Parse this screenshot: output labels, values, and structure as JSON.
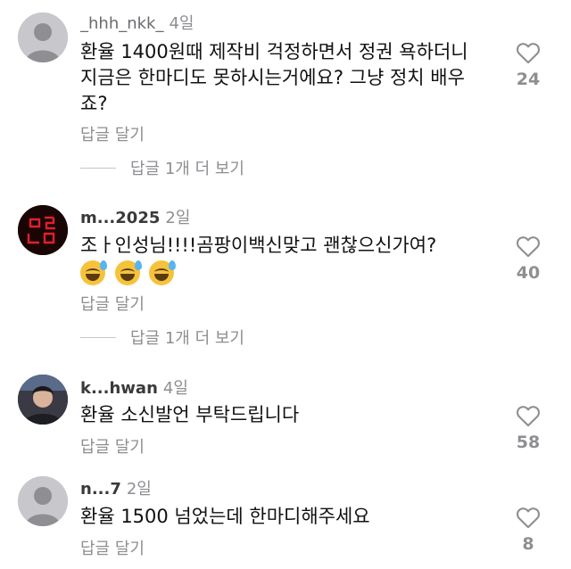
{
  "reply_label": "답글 달기",
  "comments": [
    {
      "username": "_hhh_nkk_",
      "time": "4일",
      "text": "환율 1400원때 제작비 걱정하면서 정권 욕하더니 지금은 한마디도 못하시는거에요? 그냥 정치 배우죠?",
      "likes": "24",
      "more_replies": "답글 1개 더 보기"
    },
    {
      "username": "m...2025",
      "time": "2일",
      "text": "조ㅏ인성님!!!!곰팡이백신맞고 괜찮으신가여?",
      "emoji_count": 3,
      "likes": "40",
      "more_replies": "답글 1개 더 보기"
    },
    {
      "username": "k...hwan",
      "time": "4일",
      "text": "환율 소신발언 부탁드립니다",
      "likes": "58"
    },
    {
      "username": "n...7",
      "time": "2일",
      "text": "환율 1500 넘었는데 한마디해주세요",
      "likes": "8"
    }
  ],
  "colors": {
    "secondary_text": "#8e8e93",
    "heart_outline": "#8e8e93",
    "emoji_fill": "#f5c33b"
  }
}
